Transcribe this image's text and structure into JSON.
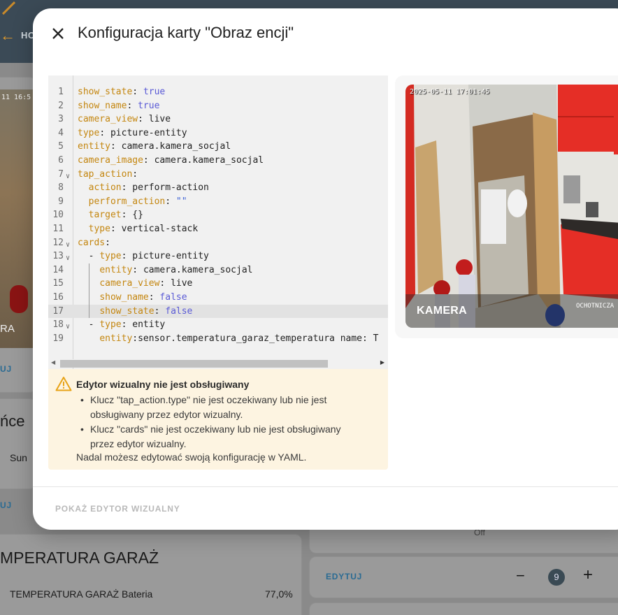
{
  "background": {
    "home_label": "HO",
    "camera_timestamp": "11 16:5",
    "camera_label": "RA",
    "edit_link_1": "UJ",
    "heading_partial": "ńce",
    "sun_label": "Sun",
    "edit_link_2": "UJ",
    "temperature_heading": "MPERATURA GARAŻ",
    "battery_row_label": "TEMPERATURA GARAŻ Bateria",
    "battery_row_value": "77,0%",
    "off_state": "Off",
    "edit_link_3": "EDYTUJ",
    "stepper_minus": "−",
    "stepper_value": "9",
    "stepper_plus": "+"
  },
  "dialog": {
    "title": "Konfiguracja karty \"Obraz encji\"",
    "close_icon": "close-icon",
    "visual_editor_button": "POKAŻ EDYTOR WIZUALNY"
  },
  "yaml": {
    "lines": [
      {
        "n": "1",
        "key": "show_state",
        "sep": ": ",
        "val": "true",
        "val_type": "bool"
      },
      {
        "n": "2",
        "key": "show_name",
        "sep": ": ",
        "val": "true",
        "val_type": "bool"
      },
      {
        "n": "3",
        "key": "camera_view",
        "sep": ": ",
        "val": "live",
        "val_type": "plain"
      },
      {
        "n": "4",
        "key": "type",
        "sep": ": ",
        "val": "picture-entity",
        "val_type": "plain"
      },
      {
        "n": "5",
        "key": "entity",
        "sep": ": ",
        "val": "camera.kamera_socjal",
        "val_type": "plain"
      },
      {
        "n": "6",
        "key": "camera_image",
        "sep": ": ",
        "val": "camera.kamera_socjal",
        "val_type": "plain"
      },
      {
        "n": "7",
        "key": "tap_action",
        "sep": ":",
        "val": "",
        "val_type": "plain",
        "fold": true
      },
      {
        "n": "8",
        "indent": "  ",
        "key": "action",
        "sep": ": ",
        "val": "perform-action",
        "val_type": "plain"
      },
      {
        "n": "9",
        "indent": "  ",
        "key": "perform_action",
        "sep": ": ",
        "val": "\"\"",
        "val_type": "str"
      },
      {
        "n": "10",
        "indent": "  ",
        "key": "target",
        "sep": ": ",
        "val": "{}",
        "val_type": "plain"
      },
      {
        "n": "11",
        "indent": "  ",
        "key": "type",
        "sep": ": ",
        "val": "vertical-stack",
        "val_type": "plain"
      },
      {
        "n": "12",
        "key": "cards",
        "sep": ":",
        "val": "",
        "val_type": "plain",
        "fold": true
      },
      {
        "n": "13",
        "indent": "  - ",
        "key": "type",
        "sep": ": ",
        "val": "picture-entity",
        "val_type": "plain",
        "fold": true
      },
      {
        "n": "14",
        "indent": "    ",
        "key": "entity",
        "sep": ": ",
        "val": "camera.kamera_socjal",
        "val_type": "plain",
        "guide": true
      },
      {
        "n": "15",
        "indent": "    ",
        "key": "camera_view",
        "sep": ": ",
        "val": "live",
        "val_type": "plain",
        "guide": true
      },
      {
        "n": "16",
        "indent": "    ",
        "key": "show_name",
        "sep": ": ",
        "val": "false",
        "val_type": "bool",
        "guide": true
      },
      {
        "n": "17",
        "indent": "    ",
        "key": "show_state",
        "sep": ": ",
        "val": "false",
        "val_type": "bool",
        "guide": true,
        "active": true
      },
      {
        "n": "18",
        "indent": "  - ",
        "key": "type",
        "sep": ": ",
        "val": "entity",
        "val_type": "plain",
        "fold": true
      },
      {
        "n": "19",
        "indent": "    ",
        "key": "entity",
        "sep": ":",
        "val": "sensor.temperatura_garaz_temperatura name: T",
        "val_type": "plain"
      }
    ]
  },
  "warning": {
    "icon": "warning-triangle-icon",
    "title": "Edytor wizualny nie jest obsługiwany",
    "items": [
      "Klucz \"tap_action.type\" nie jest oczekiwany lub nie jest obsługiwany przez edytor wizualny.",
      "Klucz \"cards\" nie jest oczekiwany lub nie jest obsługiwany przez edytor wizualny."
    ],
    "footer": "Nadal możesz edytować swoją konfigurację w YAML."
  },
  "preview": {
    "timestamp": "2025-05-11 17:01:45",
    "label": "KAMERA",
    "watermark": "OCHOTNICZA"
  },
  "colors": {
    "yaml_key": "#c4860f",
    "yaml_bool": "#5a5ad6",
    "yaml_string": "#3e62d6",
    "warning_bg": "#fdf4e1",
    "warning_icon": "#e8a317"
  }
}
